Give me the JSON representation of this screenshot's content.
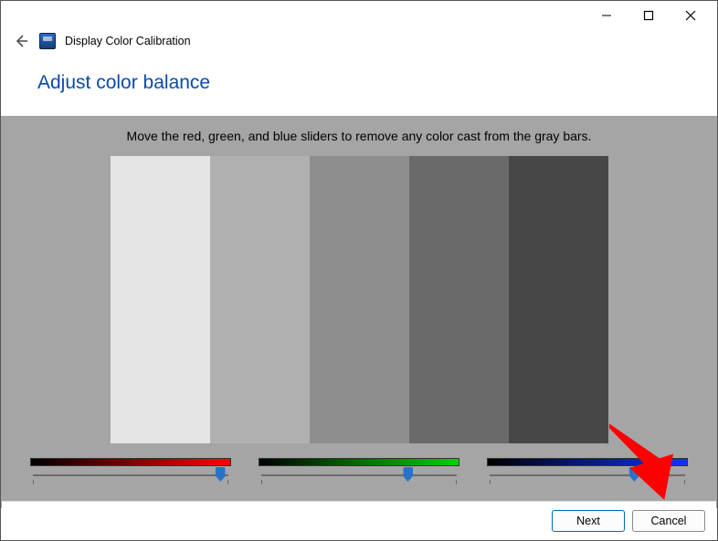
{
  "window": {
    "title": "Display Color Calibration"
  },
  "heading": "Adjust color balance",
  "instruction": "Move the red, green, and blue sliders to remove any color cast from the gray bars.",
  "gray_bars": {
    "colors": [
      "#e5e5e5",
      "#b1b1b1",
      "#8e8e8e",
      "#6a6a6a",
      "#474747"
    ]
  },
  "sliders": {
    "red": {
      "value": 96,
      "min": 0,
      "max": 100,
      "thumb_color": "#2a72c8",
      "gradient": [
        "#000000",
        "#ff0000"
      ]
    },
    "green": {
      "value": 75,
      "min": 0,
      "max": 100,
      "thumb_color": "#2a72c8",
      "gradient": [
        "#000000",
        "#00d400"
      ]
    },
    "blue": {
      "value": 74,
      "min": 0,
      "max": 100,
      "thumb_color": "#2a72c8",
      "gradient": [
        "#000000",
        "#1030ff"
      ]
    }
  },
  "buttons": {
    "next": "Next",
    "cancel": "Cancel"
  },
  "annotation": {
    "description": "red arrow pointing at Next button"
  }
}
